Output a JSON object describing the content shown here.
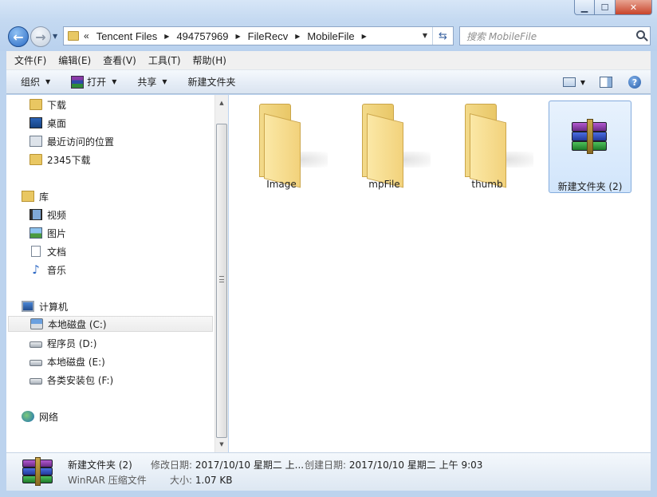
{
  "address": {
    "lead": "«",
    "crumbs": [
      "Tencent Files",
      "494757969",
      "FileRecv",
      "MobileFile"
    ]
  },
  "search": {
    "placeholder": "搜索 MobileFile"
  },
  "menu": [
    "文件(F)",
    "编辑(E)",
    "查看(V)",
    "工具(T)",
    "帮助(H)"
  ],
  "commands": {
    "organize": "组织",
    "open": "打开",
    "share": "共享",
    "new_folder": "新建文件夹"
  },
  "nav": {
    "favorites": [
      {
        "label": "下载",
        "icon": "download-folder-icon"
      },
      {
        "label": "桌面",
        "icon": "desktop-icon"
      },
      {
        "label": "最近访问的位置",
        "icon": "recent-places-icon"
      },
      {
        "label": "2345下载",
        "icon": "folder-icon"
      }
    ],
    "libraries": {
      "label": "库",
      "items": [
        {
          "label": "视频",
          "icon": "video-icon"
        },
        {
          "label": "图片",
          "icon": "picture-icon"
        },
        {
          "label": "文档",
          "icon": "document-icon"
        },
        {
          "label": "音乐",
          "icon": "music-icon"
        }
      ]
    },
    "computer": {
      "label": "计算机",
      "items": [
        {
          "label": "本地磁盘 (C:)",
          "icon": "system-drive-icon"
        },
        {
          "label": "程序员 (D:)",
          "icon": "drive-icon"
        },
        {
          "label": "本地磁盘 (E:)",
          "icon": "drive-icon"
        },
        {
          "label": "各类安装包 (F:)",
          "icon": "drive-icon"
        }
      ]
    },
    "network": {
      "label": "网络"
    }
  },
  "files": [
    {
      "name": "Image",
      "type": "folder"
    },
    {
      "name": "mpFile",
      "type": "folder"
    },
    {
      "name": "thumb",
      "type": "folder"
    },
    {
      "name": "新建文件夹 (2)",
      "type": "winrar-archive",
      "selected": true
    }
  ],
  "details": {
    "name": "新建文件夹 (2)",
    "type": "WinRAR 压缩文件",
    "modified_label": "修改日期:",
    "modified_value": "2017/10/10 星期二 上...",
    "created_label": "创建日期:",
    "created_value": "2017/10/10 星期二 上午 9:03",
    "size_label": "大小:",
    "size_value": "1.07 KB"
  },
  "colors": {
    "frame": "#bcd3ee",
    "selection": "#d1e5fb",
    "folder": "#f2d27c"
  }
}
